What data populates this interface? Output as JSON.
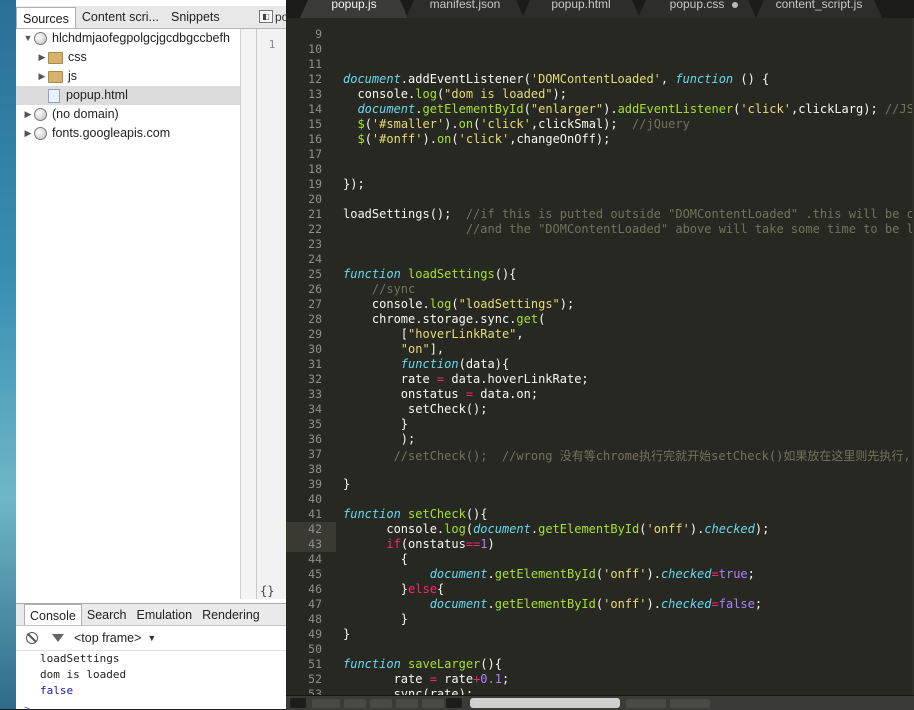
{
  "sources_panel": {
    "tabs": [
      "Sources",
      "Content scri...",
      "Snippets"
    ],
    "tree": [
      {
        "label": "hlchdmjaofegpolgcjgcdbgccbefh",
        "icon": "globe-icon",
        "expanded": true,
        "level": 0
      },
      {
        "label": "css",
        "icon": "folder-icon",
        "expanded": false,
        "level": 1
      },
      {
        "label": "js",
        "icon": "folder-icon",
        "expanded": false,
        "level": 1
      },
      {
        "label": "popup.html",
        "icon": "file-icon",
        "level": 1,
        "selected": true
      },
      {
        "label": "(no domain)",
        "icon": "globe-icon",
        "expanded": false,
        "level": 0
      },
      {
        "label": "fonts.googleapis.com",
        "icon": "globe-icon",
        "expanded": false,
        "level": 0
      }
    ],
    "mini_tab_label": "pop",
    "mini_line_number": "1",
    "format_button": "{}"
  },
  "console_drawer": {
    "tabs": [
      "Console",
      "Search",
      "Emulation",
      "Rendering"
    ],
    "frame_selector": "<top frame>",
    "messages": [
      "loadSettings",
      "dom is loaded",
      "false"
    ],
    "prompt": ">"
  },
  "editor": {
    "tabs": [
      "popup.js",
      "manifest.json",
      "popup.html",
      "popup.css",
      "content_script.js"
    ],
    "active_tab": "popup.js",
    "colors": {
      "background": "#272822",
      "keyword": "#66d9ef",
      "string": "#e6db74",
      "function": "#a6e22e",
      "comment": "#75715e",
      "number": "#ae81ff",
      "operator": "#f92672"
    },
    "highlighted_lines": [
      "42",
      "43"
    ],
    "lines": [
      {
        "n": "9",
        "tokens": []
      },
      {
        "n": "10",
        "tokens": []
      },
      {
        "n": "11",
        "tokens": []
      },
      {
        "n": "12",
        "tokens": [
          [
            "d",
            "document"
          ],
          [
            "g",
            ".addEventListener("
          ],
          [
            "s",
            "'DOMContentLoaded'"
          ],
          [
            "g",
            ", "
          ],
          [
            "k",
            "function"
          ],
          [
            "g",
            " () {"
          ]
        ]
      },
      {
        "n": "13",
        "tokens": [
          [
            "g",
            "  console."
          ],
          [
            "f",
            "log"
          ],
          [
            "g",
            "("
          ],
          [
            "s",
            "\"dom is loaded\""
          ],
          [
            "g",
            ");"
          ]
        ]
      },
      {
        "n": "14",
        "tokens": [
          [
            "g",
            "  "
          ],
          [
            "d",
            "document"
          ],
          [
            "g",
            "."
          ],
          [
            "f",
            "getElementById"
          ],
          [
            "g",
            "("
          ],
          [
            "s",
            "\"enlarger\""
          ],
          [
            "g",
            ")."
          ],
          [
            "f",
            "addEventListener"
          ],
          [
            "g",
            "("
          ],
          [
            "s",
            "'click'"
          ],
          [
            "g",
            ",clickLarg); "
          ],
          [
            "c",
            "//JS"
          ]
        ]
      },
      {
        "n": "15",
        "tokens": [
          [
            "g",
            "  "
          ],
          [
            "f",
            "$"
          ],
          [
            "g",
            "("
          ],
          [
            "s",
            "'#smaller'"
          ],
          [
            "g",
            ")."
          ],
          [
            "f",
            "on"
          ],
          [
            "g",
            "("
          ],
          [
            "s",
            "'click'"
          ],
          [
            "g",
            ",clickSmal);  "
          ],
          [
            "c",
            "//jQuery"
          ]
        ]
      },
      {
        "n": "16",
        "tokens": [
          [
            "g",
            "  "
          ],
          [
            "f",
            "$"
          ],
          [
            "g",
            "("
          ],
          [
            "s",
            "'#onff'"
          ],
          [
            "g",
            ")."
          ],
          [
            "f",
            "on"
          ],
          [
            "g",
            "("
          ],
          [
            "s",
            "'click'"
          ],
          [
            "g",
            ",changeOnOff);"
          ]
        ]
      },
      {
        "n": "17",
        "tokens": []
      },
      {
        "n": "18",
        "tokens": []
      },
      {
        "n": "19",
        "tokens": [
          [
            "g",
            "});"
          ]
        ]
      },
      {
        "n": "20",
        "tokens": []
      },
      {
        "n": "21",
        "tokens": [
          [
            "g",
            "loadSettings();  "
          ],
          [
            "c",
            "//if this is putted outside \"DOMContentLoaded\" .this will be call"
          ]
        ]
      },
      {
        "n": "22",
        "tokens": [
          [
            "g",
            "                 "
          ],
          [
            "c",
            "//and the \"DOMContentLoaded\" above will take some time to be load"
          ]
        ]
      },
      {
        "n": "23",
        "tokens": []
      },
      {
        "n": "24",
        "tokens": []
      },
      {
        "n": "25",
        "tokens": [
          [
            "k",
            "function"
          ],
          [
            "g",
            " "
          ],
          [
            "f",
            "loadSettings"
          ],
          [
            "g",
            "(){"
          ]
        ]
      },
      {
        "n": "26",
        "tokens": [
          [
            "g",
            "    "
          ],
          [
            "c",
            "//sync"
          ]
        ]
      },
      {
        "n": "27",
        "tokens": [
          [
            "g",
            "    console."
          ],
          [
            "f",
            "log"
          ],
          [
            "g",
            "("
          ],
          [
            "s",
            "\"loadSettings\""
          ],
          [
            "g",
            ");"
          ]
        ]
      },
      {
        "n": "28",
        "tokens": [
          [
            "g",
            "    chrome.storage.sync."
          ],
          [
            "f",
            "get"
          ],
          [
            "g",
            "("
          ]
        ]
      },
      {
        "n": "29",
        "tokens": [
          [
            "g",
            "        ["
          ],
          [
            "s",
            "\"hoverLinkRate\""
          ],
          [
            "g",
            ","
          ]
        ]
      },
      {
        "n": "30",
        "tokens": [
          [
            "g",
            "        "
          ],
          [
            "s",
            "\"on\""
          ],
          [
            "g",
            "],"
          ]
        ]
      },
      {
        "n": "31",
        "tokens": [
          [
            "g",
            "        "
          ],
          [
            "k",
            "function"
          ],
          [
            "g",
            "(data){"
          ]
        ]
      },
      {
        "n": "32",
        "tokens": [
          [
            "g",
            "        rate "
          ],
          [
            "o",
            "="
          ],
          [
            "g",
            " data.hoverLinkRate;"
          ]
        ]
      },
      {
        "n": "33",
        "tokens": [
          [
            "g",
            "        onstatus "
          ],
          [
            "o",
            "="
          ],
          [
            "g",
            " data.on;"
          ]
        ]
      },
      {
        "n": "34",
        "tokens": [
          [
            "g",
            "         setCheck();"
          ]
        ]
      },
      {
        "n": "35",
        "tokens": [
          [
            "g",
            "        }"
          ]
        ]
      },
      {
        "n": "36",
        "tokens": [
          [
            "g",
            "        );"
          ]
        ]
      },
      {
        "n": "37",
        "tokens": [
          [
            "g",
            "       "
          ],
          [
            "c",
            "//setCheck();  //wrong 没有等chrome执行完就开始setCheck()如果放在这里则先执行, 因"
          ]
        ]
      },
      {
        "n": "38",
        "tokens": []
      },
      {
        "n": "39",
        "tokens": [
          [
            "g",
            "}"
          ]
        ]
      },
      {
        "n": "40",
        "tokens": []
      },
      {
        "n": "41",
        "tokens": [
          [
            "k",
            "function"
          ],
          [
            "g",
            " "
          ],
          [
            "f",
            "setCheck"
          ],
          [
            "g",
            "(){"
          ]
        ]
      },
      {
        "n": "42",
        "tokens": [
          [
            "g",
            "      console."
          ],
          [
            "f",
            "log"
          ],
          [
            "g",
            "("
          ],
          [
            "d",
            "document"
          ],
          [
            "g",
            "."
          ],
          [
            "f",
            "getElementById"
          ],
          [
            "g",
            "("
          ],
          [
            "s",
            "'onff'"
          ],
          [
            "g",
            ")."
          ],
          [
            "d",
            "checked"
          ],
          [
            "g",
            ");"
          ]
        ]
      },
      {
        "n": "43",
        "tokens": [
          [
            "g",
            "      "
          ],
          [
            "o",
            "if"
          ],
          [
            "g",
            "(onstatus"
          ],
          [
            "o",
            "=="
          ],
          [
            "n",
            "1"
          ],
          [
            "g",
            ")"
          ]
        ]
      },
      {
        "n": "44",
        "tokens": [
          [
            "g",
            "        {"
          ]
        ]
      },
      {
        "n": "45",
        "tokens": [
          [
            "g",
            "            "
          ],
          [
            "d",
            "document"
          ],
          [
            "g",
            "."
          ],
          [
            "f",
            "getElementById"
          ],
          [
            "g",
            "("
          ],
          [
            "s",
            "'onff'"
          ],
          [
            "g",
            ")."
          ],
          [
            "d",
            "checked"
          ],
          [
            "o",
            "="
          ],
          [
            "n",
            "true"
          ],
          [
            "g",
            ";"
          ]
        ]
      },
      {
        "n": "46",
        "tokens": [
          [
            "g",
            "        }"
          ],
          [
            "o",
            "else"
          ],
          [
            "g",
            "{"
          ]
        ]
      },
      {
        "n": "47",
        "tokens": [
          [
            "g",
            "            "
          ],
          [
            "d",
            "document"
          ],
          [
            "g",
            "."
          ],
          [
            "f",
            "getElementById"
          ],
          [
            "g",
            "("
          ],
          [
            "s",
            "'onff'"
          ],
          [
            "g",
            ")."
          ],
          [
            "d",
            "checked"
          ],
          [
            "o",
            "="
          ],
          [
            "n",
            "false"
          ],
          [
            "g",
            ";"
          ]
        ]
      },
      {
        "n": "48",
        "tokens": [
          [
            "g",
            "        }"
          ]
        ]
      },
      {
        "n": "49",
        "tokens": [
          [
            "g",
            "}"
          ]
        ]
      },
      {
        "n": "50",
        "tokens": []
      },
      {
        "n": "51",
        "tokens": [
          [
            "k",
            "function"
          ],
          [
            "g",
            " "
          ],
          [
            "f",
            "saveLarger"
          ],
          [
            "g",
            "(){"
          ]
        ]
      },
      {
        "n": "52",
        "tokens": [
          [
            "g",
            "       rate "
          ],
          [
            "o",
            "="
          ],
          [
            "g",
            " rate"
          ],
          [
            "o",
            "+"
          ],
          [
            "n",
            "0.1"
          ],
          [
            "g",
            ";"
          ]
        ]
      },
      {
        "n": "53",
        "tokens": [
          [
            "g",
            "       sync(rate);"
          ]
        ]
      }
    ]
  }
}
